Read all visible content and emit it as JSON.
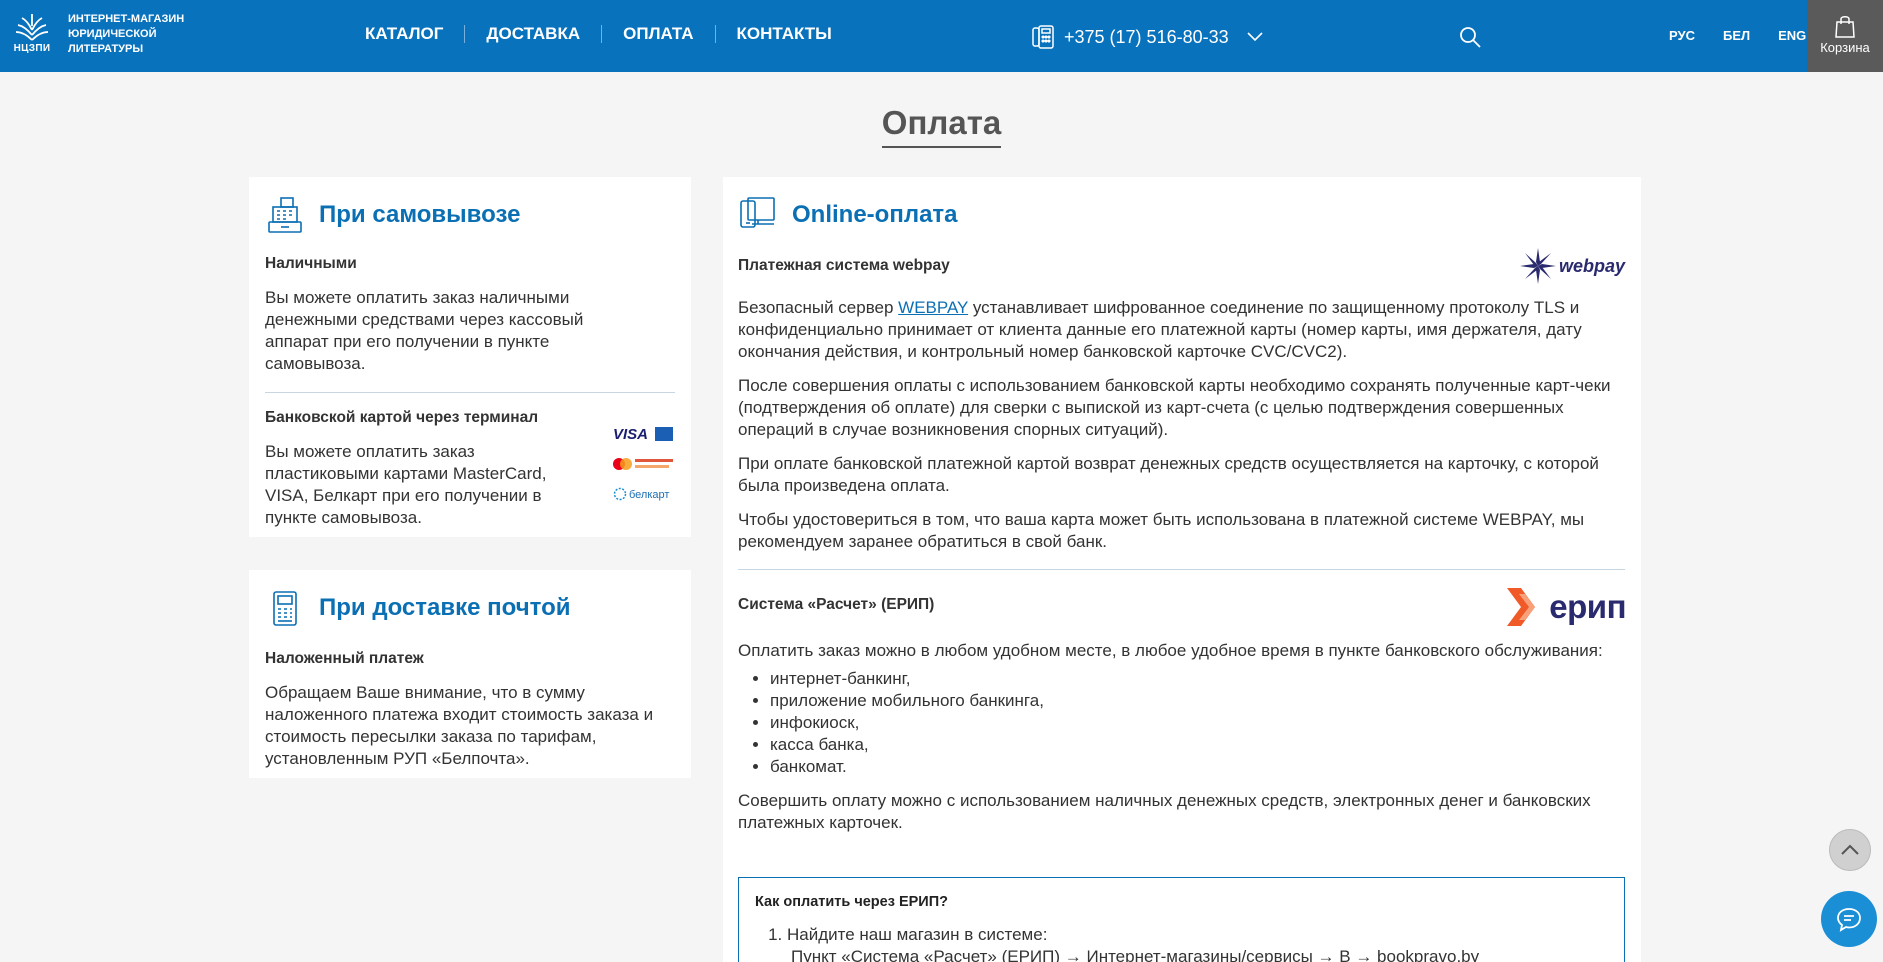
{
  "header": {
    "logo_abbr": "НЦЗПИ",
    "logo_text": "ИНТЕРНЕТ-МАГАЗИН ЮРИДИЧЕСКОЙ ЛИТЕРАТУРЫ",
    "nav": [
      "КАТАЛОГ",
      "ДОСТАВКА",
      "ОПЛАТА",
      "КОНТАКТЫ"
    ],
    "phone": "+375 (17) 516-80-33",
    "langs": [
      "РУС",
      "БЕЛ",
      "ENG"
    ],
    "cart_label": "Корзина",
    "bg_color": "#0872bd"
  },
  "page_title": "Оплата",
  "pickup": {
    "title": "При самовывозе",
    "cash_heading": "Наличными",
    "cash_text": "Вы можете оплатить заказ наличными денежными средствами через кассовый аппарат при его получении в пункте самовывоза.",
    "card_heading": "Банковской картой через терминал",
    "card_text": "Вы можете оплатить заказ пластиковыми картами MasterCard, VISA, Белкарт при его получении в пункте самовывоза.",
    "card_logos": [
      "VISA",
      "Mastercard SecureCode",
      "белкарт"
    ]
  },
  "post": {
    "title": "При доставке почтой",
    "heading": "Наложенный платеж",
    "text": "Обращаем Ваше внимание, что в сумму наложенного платежа входит стоимость заказа и стоимость пересылки заказа по тарифам, установленным РУП «Белпочта»."
  },
  "online": {
    "title": "Online-оплата",
    "webpay_heading": "Платежная система webpay",
    "webpay_logo": "webpay",
    "webpay_p1_before": "Безопасный сервер ",
    "webpay_p1_link": "WEBPAY",
    "webpay_p1_after": " устанавливает шифрованное соединение по защищенному протоколу TLS и конфиденциально принимает от клиента данные его платежной карты (номер карты, имя держателя, дату окончания действия, и контрольный номер банковской карточке CVC/CVC2).",
    "webpay_p2": "После совершения оплаты с использованием банковской карты необходимо сохранять полученные карт-чеки (подтверждения об оплате) для сверки с выпиской из карт-счета (с целью подтверждения совершенных операций в случае возникновения спорных ситуаций).",
    "webpay_p3": "При оплате банковской платежной картой возврат денежных средств осуществляется на карточку, с которой была произведена оплата.",
    "webpay_p4": "Чтобы удостовериться в том, что ваша карта может быть использована в платежной системе WEBPAY, мы рекомендуем заранее обратиться в свой банк.",
    "erip_heading": "Система «Расчет» (ЕРИП)",
    "erip_logo": "ерип",
    "erip_p1": "Оплатить заказ можно в любом удобном месте, в любое удобное время в пункте банковского обслуживания:",
    "erip_list": [
      "интернет-банкинг,",
      "приложение мобильного банкинга,",
      "инфокиоск,",
      "касса банка,",
      "банкомат."
    ],
    "erip_p2": "Совершить оплату можно с использованием наличных денежных средств, электронных денег и банковских платежных карточек.",
    "erip_box": {
      "title": "Как оплатить через ЕРИП?",
      "step1": "Найдите наш магазин в системе:",
      "step1_path": "Пункт «Система «Расчет» (ЕРИП) → Интернет-магазины/сервисы → B → bookpravo.by"
    }
  },
  "colors": {
    "accent": "#0b6fb4",
    "erip_orange": "#f05a28"
  }
}
